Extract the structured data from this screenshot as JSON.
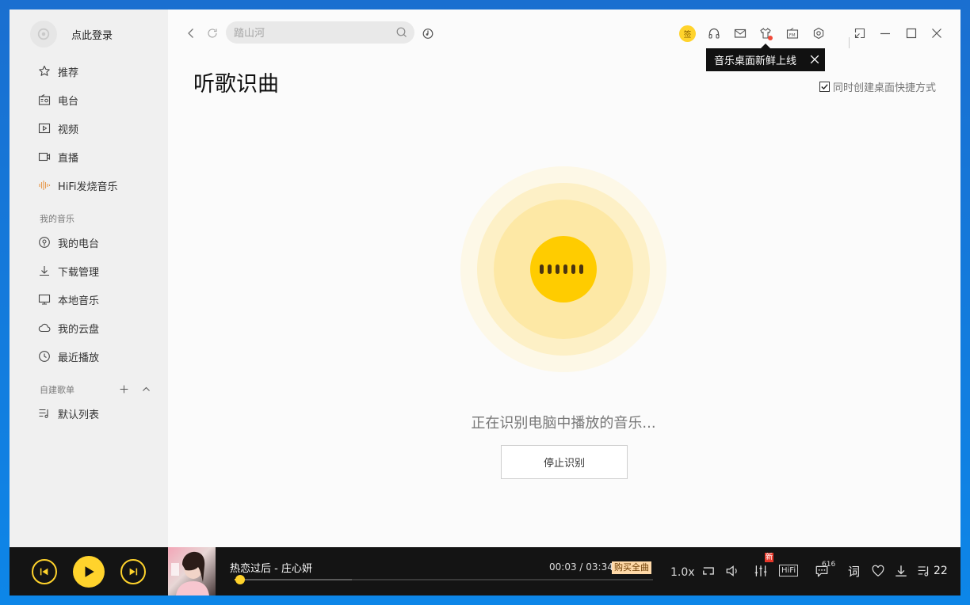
{
  "sidebar": {
    "login_label": "点此登录",
    "nav": [
      {
        "label": "推荐",
        "icon": "star-icon"
      },
      {
        "label": "电台",
        "icon": "radio-icon"
      },
      {
        "label": "视频",
        "icon": "video-icon"
      },
      {
        "label": "直播",
        "icon": "live-camera-icon"
      },
      {
        "label": "HiFi发烧音乐",
        "icon": "sound-wave-icon"
      }
    ],
    "my_music": {
      "title": "我的音乐",
      "items": [
        {
          "label": "我的电台",
          "icon": "my-radio-icon"
        },
        {
          "label": "下载管理",
          "icon": "download-icon"
        },
        {
          "label": "本地音乐",
          "icon": "monitor-icon"
        },
        {
          "label": "我的云盘",
          "icon": "cloud-icon"
        },
        {
          "label": "最近播放",
          "icon": "clock-icon"
        }
      ]
    },
    "playlists": {
      "title": "自建歌单",
      "items": [
        {
          "label": "默认列表",
          "icon": "playlist-icon"
        }
      ]
    }
  },
  "topbar": {
    "search_placeholder": "踏山河",
    "sign_label": "签",
    "tooltip": "音乐桌面新鲜上线"
  },
  "main": {
    "title": "听歌识曲",
    "shortcut_label": "同时创建桌面快捷方式",
    "shortcut_checked": true,
    "status_text": "正在识别电脑中播放的音乐...",
    "stop_button": "停止识别"
  },
  "player": {
    "song": "热恋过后 - 庄心妍",
    "current_time": "00:03",
    "total_time": "/ 03:34",
    "buy_label": "购买全曲",
    "speed": "1.0x",
    "new_badge": "新",
    "hifi": "HiFi",
    "comment_count": "616",
    "lyrics_label": "词",
    "queue_count": "22",
    "progress_fraction": 0.014,
    "buffered_fraction": 0.28,
    "accent": "#ffd32c"
  }
}
